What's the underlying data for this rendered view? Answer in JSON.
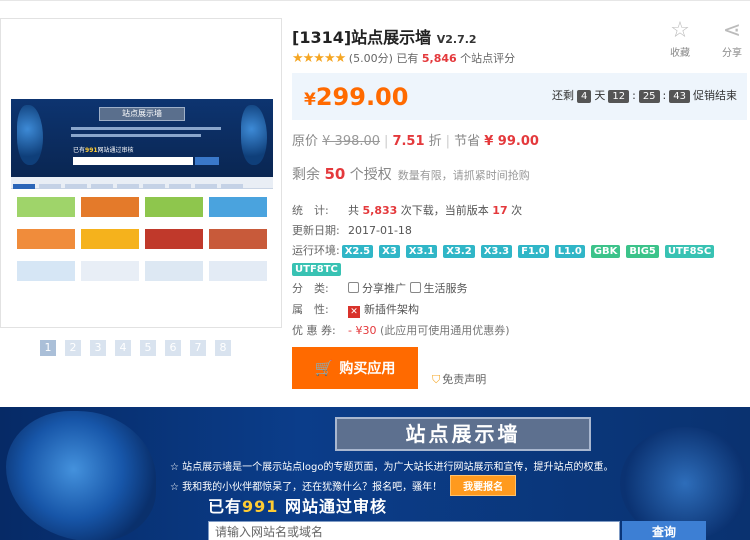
{
  "product": {
    "title": "[1314]站点展示墙",
    "version": "V2.7.2",
    "rating_score": "(5.00分)",
    "rating_prefix": "已有",
    "rating_count": "5,846",
    "rating_suffix": "个站点评分",
    "stars": "★★★★★"
  },
  "tools": {
    "favorite": "收藏",
    "share": "分享"
  },
  "price": {
    "currency": "¥",
    "value": "299.00",
    "countdown_prefix": "还剩",
    "days": "4",
    "day_label": "天",
    "hours": "12",
    "minutes": "25",
    "seconds": "43",
    "countdown_suffix": "促销结束"
  },
  "original": {
    "label": "原价",
    "price": "¥ 398.00",
    "discount": "7.51",
    "discount_unit": "折",
    "save_label": "节省",
    "save_value": "¥ 99.00"
  },
  "stock": {
    "prefix": "剩余",
    "count": "50",
    "suffix": "个授权",
    "note": "数量有限，请抓紧时间抢购"
  },
  "stats": {
    "label": "统　计:",
    "text1": "共",
    "downloads": "5,833",
    "text2": "次下载，当前版本",
    "version_downloads": "17",
    "text3": "次"
  },
  "updated": {
    "label": "更新日期:",
    "value": "2017-01-18"
  },
  "env": {
    "label": "运行环境:",
    "tags": [
      "X2.5",
      "X3",
      "X3.1",
      "X3.2",
      "X3.3",
      "F1.0",
      "L1.0",
      "GBK",
      "BIG5",
      "UTF8SC",
      "UTF8TC"
    ]
  },
  "category": {
    "label": "分　类:",
    "items": [
      "分享推广",
      "生活服务"
    ]
  },
  "attribute": {
    "label": "属　性:",
    "value": "新插件架构"
  },
  "coupon": {
    "label": "优 惠 券:",
    "value": "- ¥30",
    "note": "(此应用可使用通用优惠券)"
  },
  "buy_label": "购买应用",
  "disclaimer": "免责声明",
  "thumb_pages": [
    "1",
    "2",
    "3",
    "4",
    "5",
    "6",
    "7",
    "8"
  ],
  "preview": {
    "title": "站点展示墙",
    "line1": "☆ 站点展示墙是一个展示站点logo的专题页面，为广大站长进行网站展示和宣传，提升站点的权重。",
    "line2": "☆ 我和我的小伙伴都惊呆了，还在犹豫什么？报名吧，骚年！",
    "apply": "我要报名",
    "count_prefix": "已有",
    "count": "991",
    "count_suffix": "网站通过审核",
    "search_placeholder": "请输入网站名或域名",
    "search_btn": "查询"
  }
}
